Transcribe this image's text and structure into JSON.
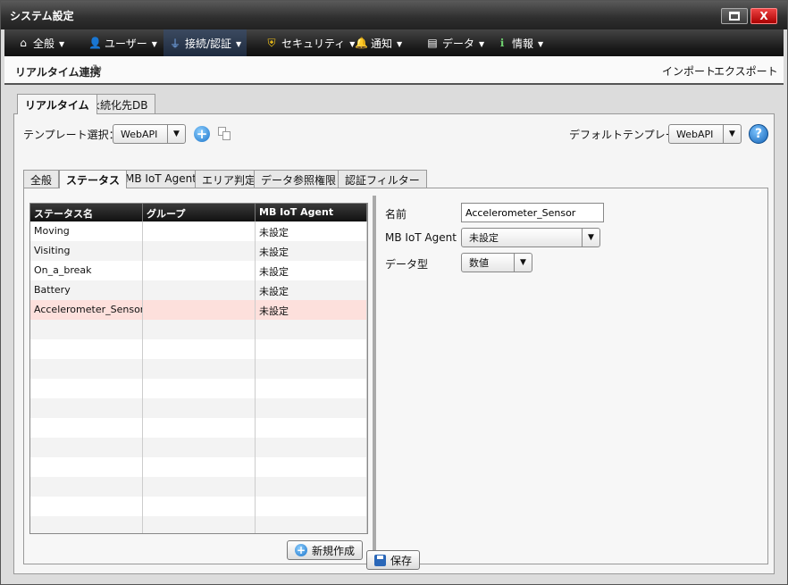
{
  "window": {
    "title": "システム設定",
    "close_label": "X"
  },
  "menu": [
    {
      "label": "全般",
      "icon": "home-icon"
    },
    {
      "label": "ユーザー",
      "icon": "user-icon"
    },
    {
      "label": "接続/認証",
      "icon": "plug-icon"
    },
    {
      "label": "セキュリティ",
      "icon": "shield-icon"
    },
    {
      "label": "通知",
      "icon": "bell-icon"
    },
    {
      "label": "データ",
      "icon": "data-icon"
    },
    {
      "label": "情報",
      "icon": "info-icon"
    }
  ],
  "breadcrumb": {
    "title": "リアルタイム連携",
    "import": "インポート",
    "export": "エクスポート"
  },
  "outer_tabs": [
    "リアルタイム",
    "永続化先DB"
  ],
  "template": {
    "label": "テンプレート選択：",
    "value": "WebAPI",
    "default_label": "デフォルトテンプレート",
    "default_value": "WebAPI"
  },
  "inner_tabs": [
    "全般",
    "ステータス",
    "MB IoT Agent",
    "エリア判定",
    "データ参照権限",
    "認証フィルター"
  ],
  "grid": {
    "columns": [
      "ステータス名",
      "グループ",
      "MB IoT Agent"
    ],
    "rows": [
      [
        "Moving",
        "",
        "未設定"
      ],
      [
        "Visiting",
        "",
        "未設定"
      ],
      [
        "On_a_break",
        "",
        "未設定"
      ],
      [
        "Battery",
        "",
        "未設定"
      ],
      [
        "Accelerometer_Sensor",
        "",
        "未設定"
      ]
    ],
    "selected_row": 4
  },
  "new_button": "新規作成",
  "form": {
    "name_label": "名前",
    "name_value": "Accelerometer_Sensor",
    "agent_label": "MB IoT Agent",
    "agent_value": "未設定",
    "type_label": "データ型",
    "type_value": "数値"
  },
  "save_button": "保存"
}
